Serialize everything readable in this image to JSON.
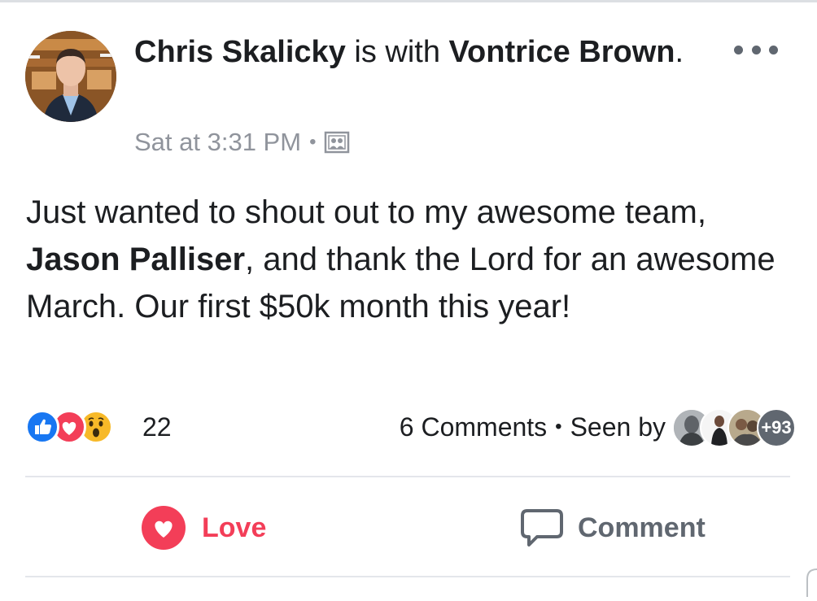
{
  "post": {
    "author": "Chris Skalicky",
    "with_text": " is with ",
    "tagged_person": "Vontrice Brown",
    "tagged_suffix": ".",
    "timestamp": "Sat at 3:31 PM",
    "separator": "•",
    "audience_icon": "photo-album-icon",
    "body": {
      "part1": "Just wanted to shout out to my awesome team, ",
      "mention": "Jason Palliser",
      "part2": ", and thank the Lord for an awesome March. Our first $50k month this year!"
    }
  },
  "reactions": {
    "icons": [
      "like-reaction-icon",
      "love-reaction-icon",
      "wow-reaction-icon"
    ],
    "count": "22"
  },
  "engagement": {
    "comments": "6 Comments",
    "separator": "•",
    "seen_by_label": "Seen by",
    "seen_more": "+93"
  },
  "actions": {
    "love_label": "Love",
    "comment_label": "Comment"
  },
  "colors": {
    "love_red": "#f33e58",
    "like_blue": "#1877f2",
    "wow_yellow": "#f7b928",
    "timestamp_gray": "#90949c",
    "icon_gray": "#606770"
  }
}
